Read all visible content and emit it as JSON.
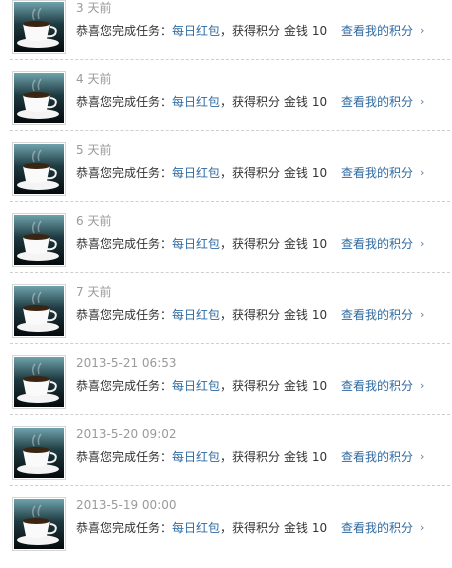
{
  "feed": {
    "items": [
      {
        "time": "3 天前",
        "prefix": "恭喜您完成任务：",
        "task": "每日红包",
        "sep": "，",
        "earned": "获得积分",
        "coin_label": "金钱",
        "coin_value": "10",
        "link": "查看我的积分",
        "chevron": "›"
      },
      {
        "time": "4 天前",
        "prefix": "恭喜您完成任务：",
        "task": "每日红包",
        "sep": "，",
        "earned": "获得积分",
        "coin_label": "金钱",
        "coin_value": "10",
        "link": "查看我的积分",
        "chevron": "›"
      },
      {
        "time": "5 天前",
        "prefix": "恭喜您完成任务：",
        "task": "每日红包",
        "sep": "，",
        "earned": "获得积分",
        "coin_label": "金钱",
        "coin_value": "10",
        "link": "查看我的积分",
        "chevron": "›"
      },
      {
        "time": "6 天前",
        "prefix": "恭喜您完成任务：",
        "task": "每日红包",
        "sep": "，",
        "earned": "获得积分",
        "coin_label": "金钱",
        "coin_value": "10",
        "link": "查看我的积分",
        "chevron": "›"
      },
      {
        "time": "7 天前",
        "prefix": "恭喜您完成任务：",
        "task": "每日红包",
        "sep": "，",
        "earned": "获得积分",
        "coin_label": "金钱",
        "coin_value": "10",
        "link": "查看我的积分",
        "chevron": "›"
      },
      {
        "time": "2013-5-21 06:53",
        "prefix": "恭喜您完成任务：",
        "task": "每日红包",
        "sep": "，",
        "earned": "获得积分",
        "coin_label": "金钱",
        "coin_value": "10",
        "link": "查看我的积分",
        "chevron": "›"
      },
      {
        "time": "2013-5-20 09:02",
        "prefix": "恭喜您完成任务：",
        "task": "每日红包",
        "sep": "，",
        "earned": "获得积分",
        "coin_label": "金钱",
        "coin_value": "10",
        "link": "查看我的积分",
        "chevron": "›"
      },
      {
        "time": "2013-5-19 00:00",
        "prefix": "恭喜您完成任务：",
        "task": "每日红包",
        "sep": "，",
        "earned": "获得积分",
        "coin_label": "金钱",
        "coin_value": "10",
        "link": "查看我的积分",
        "chevron": "›"
      }
    ],
    "icon": "coffee-cup-icon",
    "colors": {
      "link": "#2f6aa0",
      "time": "#9a9a9a",
      "text": "#333333"
    }
  }
}
